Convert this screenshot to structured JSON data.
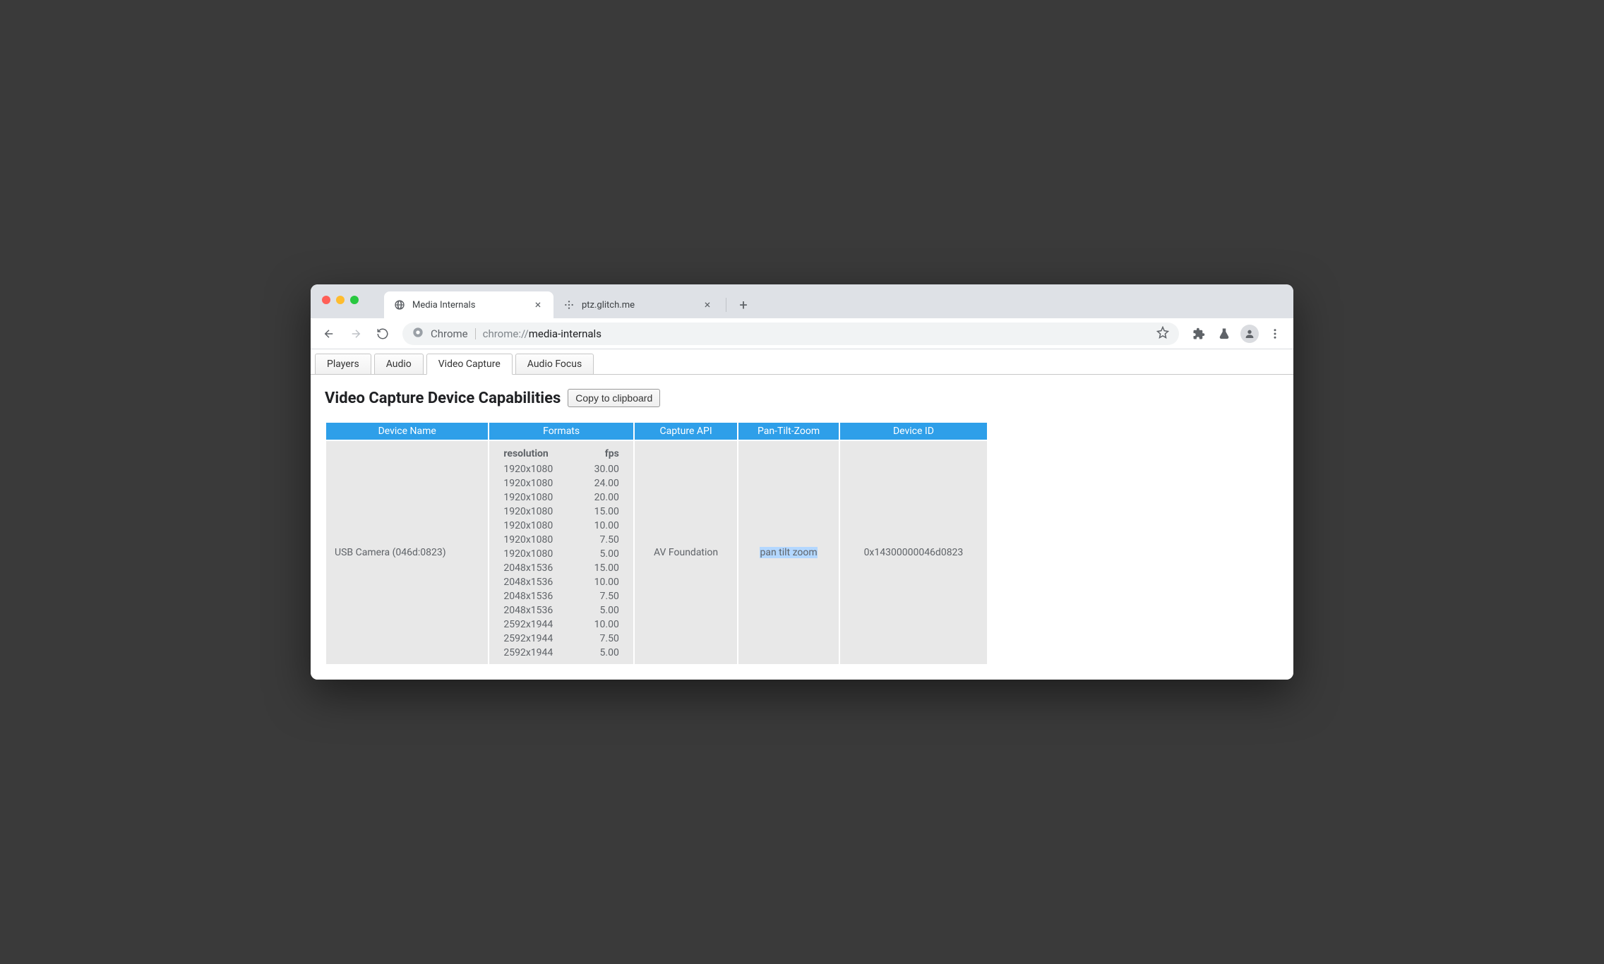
{
  "browser": {
    "tabs": [
      {
        "title": "Media Internals",
        "active": true
      },
      {
        "title": "ptz.glitch.me",
        "active": false
      }
    ]
  },
  "omnibox": {
    "origin_label": "Chrome",
    "url_dim": "chrome://",
    "url_path": "media-internals"
  },
  "page_tabs": [
    {
      "label": "Players",
      "active": false
    },
    {
      "label": "Audio",
      "active": false
    },
    {
      "label": "Video Capture",
      "active": true
    },
    {
      "label": "Audio Focus",
      "active": false
    }
  ],
  "heading": "Video Capture Device Capabilities",
  "copy_button": "Copy to clipboard",
  "table": {
    "columns": [
      "Device Name",
      "Formats",
      "Capture API",
      "Pan-Tilt-Zoom",
      "Device ID"
    ],
    "formats_header": {
      "resolution": "resolution",
      "fps": "fps"
    },
    "row": {
      "device_name": "USB Camera (046d:0823)",
      "capture_api": "AV Foundation",
      "ptz": "pan tilt zoom",
      "device_id": "0x14300000046d0823",
      "formats": [
        {
          "resolution": "1920x1080",
          "fps": "30.00"
        },
        {
          "resolution": "1920x1080",
          "fps": "24.00"
        },
        {
          "resolution": "1920x1080",
          "fps": "20.00"
        },
        {
          "resolution": "1920x1080",
          "fps": "15.00"
        },
        {
          "resolution": "1920x1080",
          "fps": "10.00"
        },
        {
          "resolution": "1920x1080",
          "fps": "7.50"
        },
        {
          "resolution": "1920x1080",
          "fps": "5.00"
        },
        {
          "resolution": "2048x1536",
          "fps": "15.00"
        },
        {
          "resolution": "2048x1536",
          "fps": "10.00"
        },
        {
          "resolution": "2048x1536",
          "fps": "7.50"
        },
        {
          "resolution": "2048x1536",
          "fps": "5.00"
        },
        {
          "resolution": "2592x1944",
          "fps": "10.00"
        },
        {
          "resolution": "2592x1944",
          "fps": "7.50"
        },
        {
          "resolution": "2592x1944",
          "fps": "5.00"
        }
      ]
    }
  }
}
